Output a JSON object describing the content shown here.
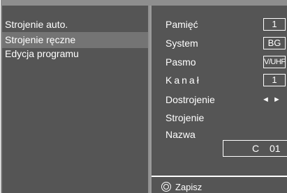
{
  "menu": {
    "items": [
      {
        "label": "Strojenie auto."
      },
      {
        "label": "Strojenie ręczne"
      },
      {
        "label": "Edycja programu"
      }
    ]
  },
  "settings": {
    "memory_label": "Pamięć",
    "memory_value": "1",
    "system_label": "System",
    "system_value": "BG",
    "band_label": "Pasmo",
    "band_value": "V/UHF",
    "channel_label": "Kanał",
    "channel_value": "1",
    "finetune_label": "Dostrojenie",
    "finetune_arrows": "◄ ►",
    "tuning_label": "Strojenie",
    "name_label": "Nazwa",
    "name_prefix": "C",
    "name_number": "01"
  },
  "footer": {
    "save_label": "Zapisz",
    "save_icon": "circle-button-icon"
  },
  "colors": {
    "panel": "#555555",
    "frame": "#8e8e8e",
    "selected": "#747474",
    "text": "#ffffff"
  }
}
